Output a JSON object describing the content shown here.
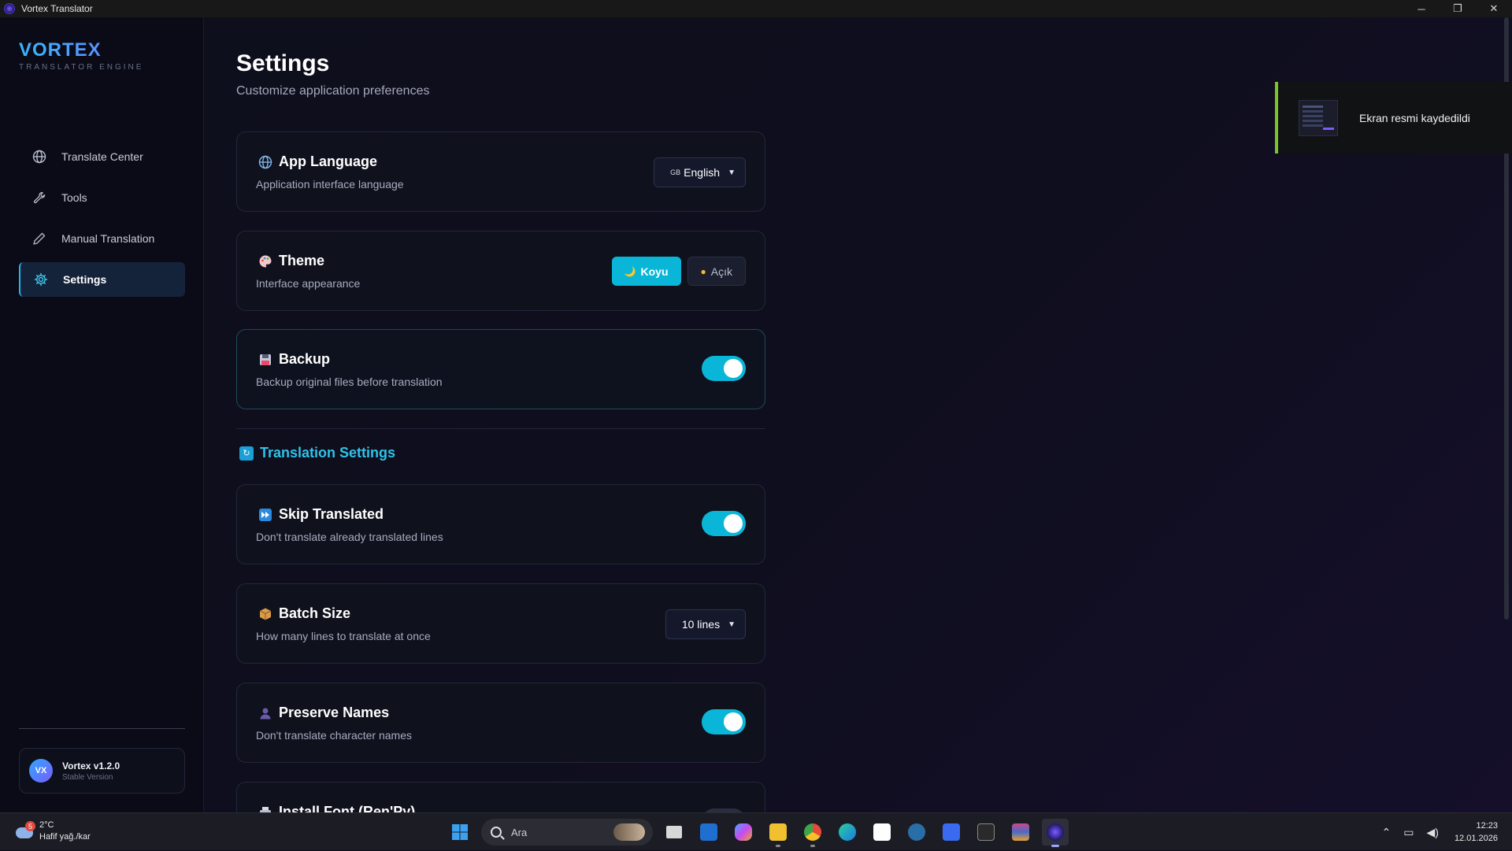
{
  "window": {
    "title": "Vortex Translator",
    "controls": {
      "minimize": "─",
      "restore": "❐",
      "close": "✕"
    }
  },
  "sidebar": {
    "brand": "VORTEX",
    "brand_sub": "TRANSLATOR ENGINE",
    "items": [
      {
        "label": "Translate Center",
        "icon": "globe-icon",
        "active": false
      },
      {
        "label": "Tools",
        "icon": "wrench-icon",
        "active": false
      },
      {
        "label": "Manual Translation",
        "icon": "pencil-icon",
        "active": false
      },
      {
        "label": "Settings",
        "icon": "gear-icon",
        "active": true
      }
    ],
    "version": {
      "initials": "VX",
      "name": "Vortex v1.2.0",
      "sub": "Stable Version"
    }
  },
  "main": {
    "title": "Settings",
    "subtitle": "Customize application preferences",
    "app_language": {
      "title": "App Language",
      "desc": "Application interface language",
      "flag": "GB",
      "value": "English"
    },
    "theme": {
      "title": "Theme",
      "desc": "Interface appearance",
      "dark_label": "Koyu",
      "light_label": "Açık",
      "selected": "Koyu"
    },
    "backup": {
      "title": "Backup",
      "desc": "Backup original files before translation",
      "enabled": true
    },
    "translation_section": "Translation Settings",
    "skip_translated": {
      "title": "Skip Translated",
      "desc": "Don't translate already translated lines",
      "enabled": true
    },
    "batch_size": {
      "title": "Batch Size",
      "desc": "How many lines to translate at once",
      "value": "10 lines"
    },
    "preserve_names": {
      "title": "Preserve Names",
      "desc": "Don't translate character names",
      "enabled": true
    },
    "install_font": {
      "title": "Install Font (Ren'Py)"
    }
  },
  "toast": {
    "text": "Ekran resmi kaydedildi"
  },
  "taskbar": {
    "weather": {
      "temp": "2°C",
      "desc": "Hafif yağ./kar",
      "badge": "5"
    },
    "search_placeholder": "Ara",
    "time": "12:23",
    "date": "12.01.2026",
    "colors": {
      "accent": "#0ab6d8",
      "toast_bar": "#7dc42a"
    }
  }
}
